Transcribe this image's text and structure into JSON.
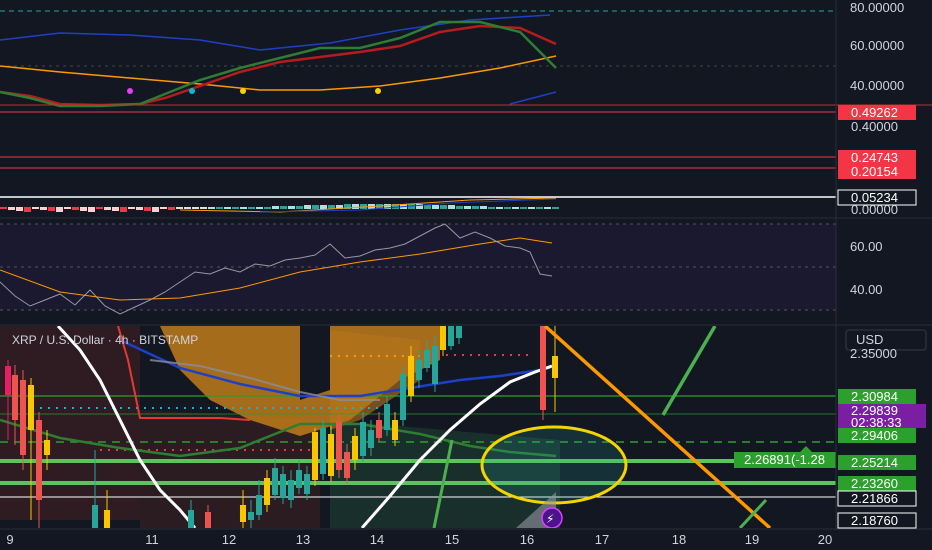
{
  "header": {
    "symbol_title": "XRP / U.S. Dollar · 4h · BITSTAMP",
    "currency_button": "USD"
  },
  "colors": {
    "background": "#131722",
    "axis_bg": "#131722",
    "up_candle": "#26a69a",
    "down_candle": "#ef5350",
    "yellow_candle": "#f7c600",
    "pink_candle": "#e91e63",
    "price_tag_green": "#2ca02c",
    "price_tag_red": "#f23645",
    "price_tag_purple": "#7b1fa2",
    "orange_line": "#ff9800",
    "cloud_orange": "#d68a1a",
    "circle_yellow": "#f5d400"
  },
  "chart_data": [
    {
      "type": "line",
      "pane": "stoch_rsi",
      "yticks": [
        "80.00000",
        "60.00000",
        "40.00000"
      ],
      "ylim": [
        30,
        85
      ],
      "series": [
        {
          "color": "#2e7d32",
          "values": [
            37,
            33,
            24,
            22,
            36,
            45,
            50,
            52,
            55,
            58,
            62,
            66,
            72,
            71,
            65,
            48
          ]
        },
        {
          "color": "#b71c1c",
          "values": [
            38,
            34,
            28,
            26,
            33,
            42,
            48,
            51,
            54,
            57,
            60,
            64,
            70,
            72,
            68,
            60
          ]
        },
        {
          "color": "#ff9800",
          "values": [
            50,
            47,
            44,
            41,
            39,
            38,
            38,
            38,
            39,
            41,
            44,
            46,
            49,
            52,
            54,
            56
          ]
        }
      ]
    },
    {
      "type": "line",
      "pane": "oscillator_levels",
      "yticks": [
        "0.40000"
      ],
      "tags": [
        "0.49262",
        "0.24743",
        "0.20154"
      ]
    },
    {
      "type": "bar",
      "pane": "macd_histogram",
      "yticks": [
        "0.00000"
      ],
      "tags": [
        "0.05234"
      ]
    },
    {
      "type": "line",
      "pane": "rsi",
      "yticks": [
        "60.00",
        "40.00"
      ],
      "ylim": [
        30,
        75
      ],
      "series": [
        {
          "color": "#9598a1",
          "values": [
            42,
            38,
            35,
            36,
            40,
            44,
            46,
            48,
            52,
            55,
            57,
            60,
            66,
            69,
            64,
            55,
            52
          ]
        },
        {
          "color": "#ff9800",
          "values": [
            45,
            43,
            41,
            40,
            40,
            41,
            43,
            45,
            47,
            50,
            52,
            54,
            57,
            59,
            61,
            62,
            61
          ]
        }
      ]
    },
    {
      "type": "line",
      "pane": "price",
      "title": "XRP / U.S. Dollar · 4h · BITSTAMP",
      "x_ticks": [
        "9",
        "11",
        "12",
        "13",
        "14",
        "15",
        "16",
        "17",
        "18",
        "19",
        "20"
      ],
      "y_ticks": [
        "2.35000"
      ],
      "ylim": [
        2.17,
        2.38
      ],
      "price_tags": [
        {
          "value": "2.30984",
          "color": "#2ca02c"
        },
        {
          "value": "2.29839",
          "color": "#7b1fa2"
        },
        {
          "value": "02:38:33",
          "color": "#7b1fa2"
        },
        {
          "value": "2.29406",
          "color": "#2ca02c"
        },
        {
          "value": "2.25214",
          "color": "#2ca02c"
        },
        {
          "value": "2.23260",
          "color": "#2ca02c"
        },
        {
          "value": "2.21866",
          "color": "#131722"
        },
        {
          "value": "2.18760",
          "color": "#131722"
        }
      ],
      "annotation": "2.26891(-1.28",
      "horizontal_levels": [
        2.30984,
        2.29406,
        2.25214,
        2.2326,
        2.21866
      ]
    }
  ]
}
